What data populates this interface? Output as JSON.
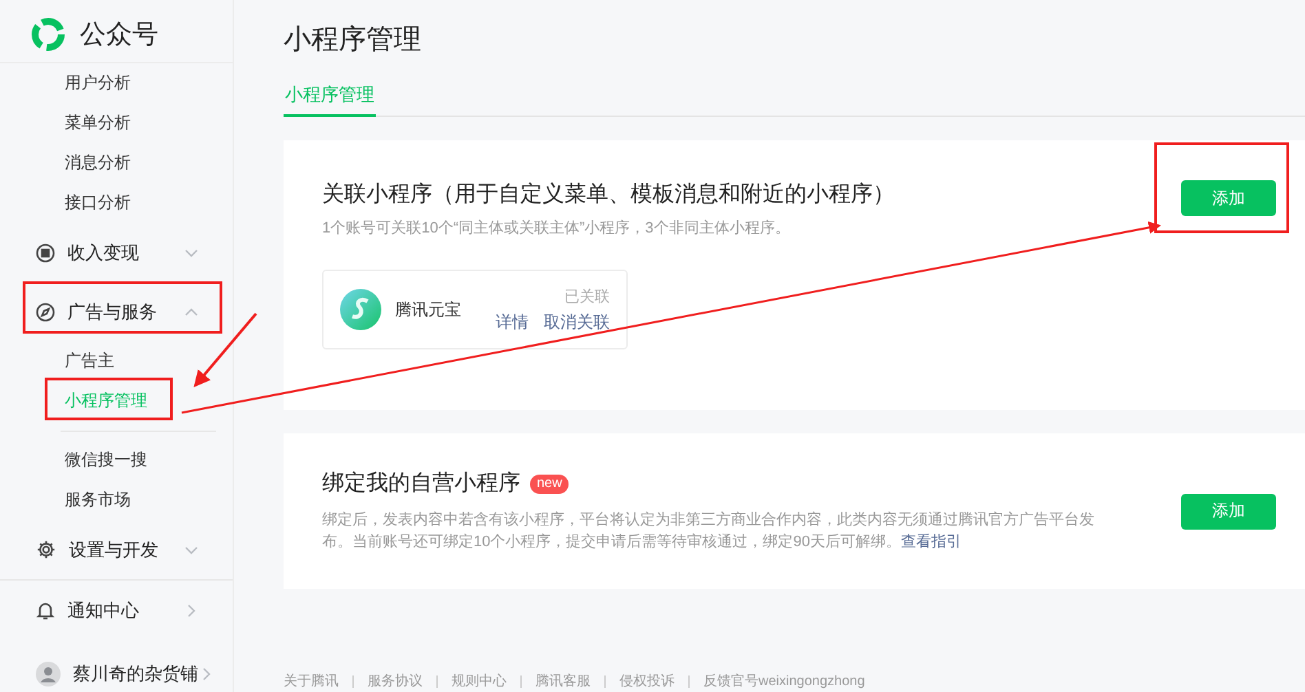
{
  "sidebar": {
    "logo_text": "公众号",
    "items": [
      {
        "kind": "sub",
        "label": "用户分析",
        "selected": false
      },
      {
        "kind": "sub",
        "label": "菜单分析",
        "selected": false
      },
      {
        "kind": "sub",
        "label": "消息分析",
        "selected": false
      },
      {
        "kind": "sub",
        "label": "接口分析",
        "selected": false
      },
      {
        "kind": "group",
        "label": "收入变现",
        "expanded": false
      },
      {
        "kind": "group",
        "label": "广告与服务",
        "expanded": true,
        "children": [
          {
            "label": "广告主",
            "selected": false
          },
          {
            "label": "小程序管理",
            "selected": true,
            "divider_after": true
          },
          {
            "label": "微信搜一搜",
            "selected": false
          },
          {
            "label": "服务市场",
            "selected": false
          }
        ]
      },
      {
        "kind": "group",
        "label": "设置与开发",
        "expanded": false
      },
      {
        "kind": "link",
        "label": "通知中心"
      },
      {
        "kind": "account",
        "label": "蔡川奇的杂货铺"
      }
    ]
  },
  "page": {
    "title": "小程序管理",
    "tabs": [
      {
        "label": "小程序管理",
        "selected": true
      }
    ]
  },
  "linked_section": {
    "title": "关联小程序（用于自定义菜单、模板消息和附近的小程序）",
    "description": "1个账号可关联10个“同主体或关联主体”小程序，3个非同主体小程序。",
    "button": "添加",
    "mini_programs": [
      {
        "name": "腾讯元宝",
        "status": "已关联",
        "actions": [
          "详情",
          "取消关联"
        ]
      }
    ]
  },
  "own_section": {
    "title": "绑定我的自营小程序",
    "badge": "new",
    "description": "绑定后，发表内容中若含有该小程序，平台将认定为非第三方商业合作内容，此类内容无须通过腾讯官方广告平台发布。当前账号还可绑定10个小程序，提交申请后需等待审核通过，绑定90天后可解绑。",
    "link": "查看指引",
    "button": "添加"
  },
  "footer": {
    "links": [
      "关于腾讯",
      "服务协议",
      "规则中心",
      "腾讯客服",
      "侵权投诉",
      "反馈官号weixingongzhong"
    ]
  }
}
